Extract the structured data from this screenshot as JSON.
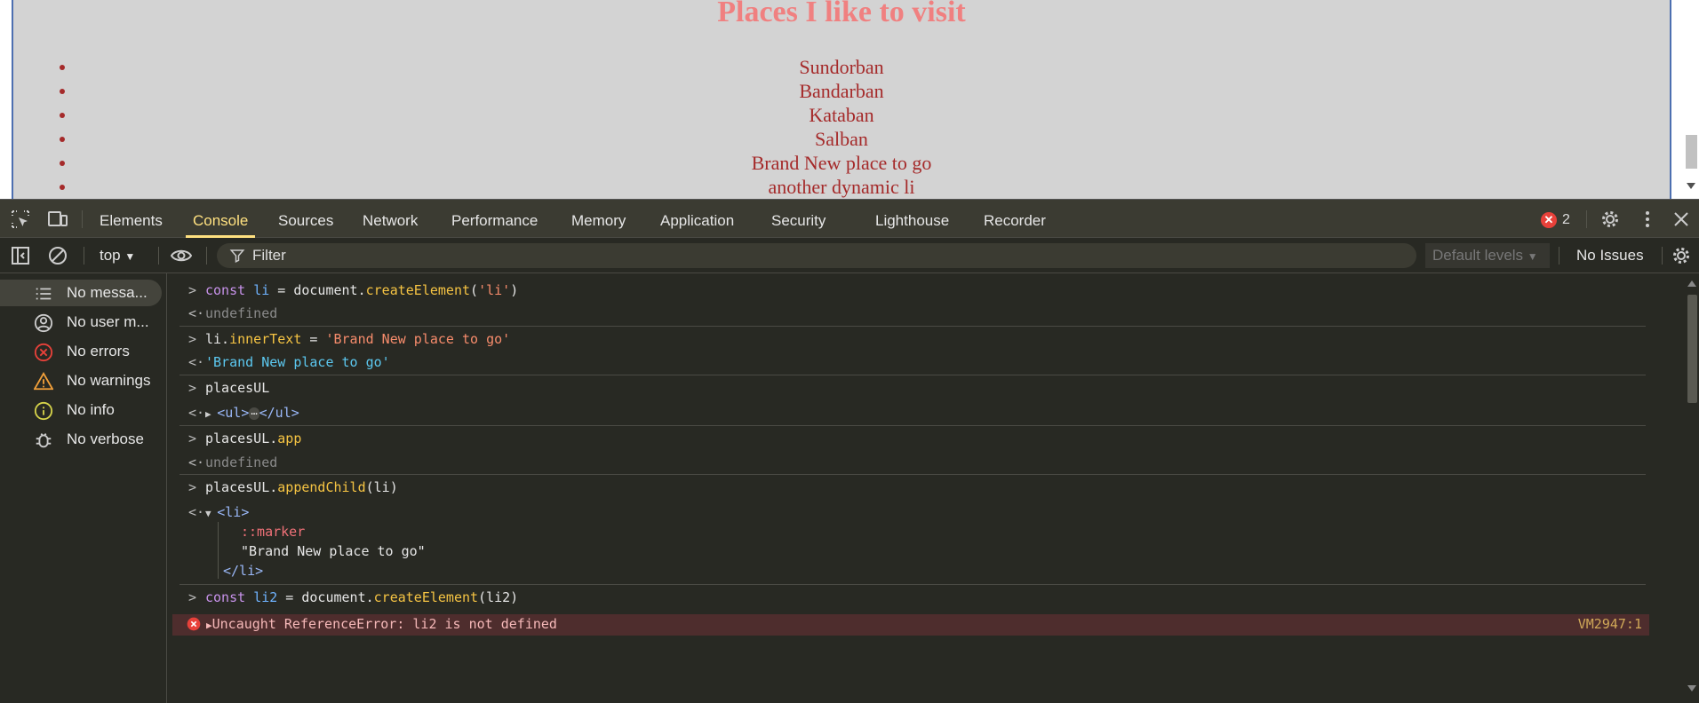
{
  "page": {
    "title": "Places I like to visit",
    "places": [
      "Sundorban",
      "Bandarban",
      "Kataban",
      "Salban",
      "Brand New place to go",
      "another dynamic li"
    ]
  },
  "devtools": {
    "tabs": [
      "Elements",
      "Console",
      "Sources",
      "Network",
      "Performance",
      "Memory",
      "Application",
      "Security",
      "Lighthouse",
      "Recorder"
    ],
    "active_tab": "Console",
    "error_count": "2",
    "toolbar": {
      "context": "top",
      "filter_placeholder": "Filter",
      "levels": "Default levels",
      "issues": "No Issues"
    },
    "sidebar": [
      {
        "label": "No messa...",
        "icon": "list-icon"
      },
      {
        "label": "No user m...",
        "icon": "user-icon"
      },
      {
        "label": "No errors",
        "icon": "error-icon"
      },
      {
        "label": "No warnings",
        "icon": "warning-icon"
      },
      {
        "label": "No info",
        "icon": "info-icon"
      },
      {
        "label": "No verbose",
        "icon": "bug-icon"
      }
    ],
    "console": {
      "c1": {
        "kw": "const",
        "var": "li",
        "eq": " = document.",
        "fn": "createElement",
        "open": "(",
        "str": "'li'",
        "close": ")"
      },
      "r1": "undefined",
      "c2": {
        "obj": "li.",
        "prop": "innerText",
        "eq": " = ",
        "str": "'Brand New place to go'"
      },
      "r2": "'Brand New place to go'",
      "c3": "placesUL",
      "r3": {
        "open": "<ul>",
        "ellipsis": "⋯",
        "close": "</ul>"
      },
      "c4": {
        "obj": "placesUL.",
        "prop": "app"
      },
      "r4": "undefined",
      "c5": {
        "obj": "placesUL.",
        "fn": "appendChild",
        "args": "(li)"
      },
      "r5": {
        "open": "<li>",
        "marker": "::marker",
        "text": "\"Brand New place to go\"",
        "close": "</li>"
      },
      "c6": {
        "kw": "const",
        "var": "li2",
        "eq": " = document.",
        "fn": "createElement",
        "args": "(li2)"
      },
      "error": {
        "message": "Uncaught ReferenceError: li2 is not defined",
        "source": "VM2947:1"
      }
    }
  }
}
